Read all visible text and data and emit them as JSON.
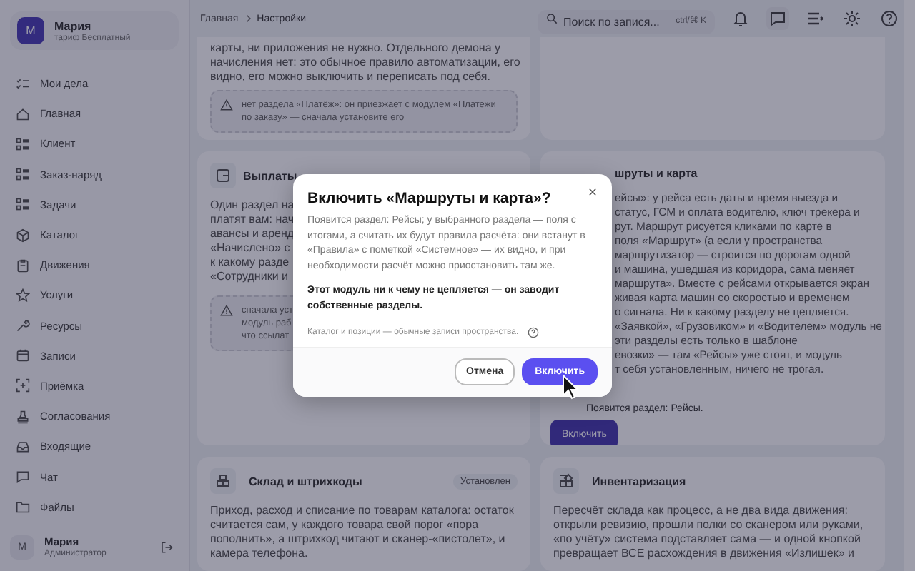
{
  "sidebar": {
    "user": {
      "initial": "М",
      "name": "Мария",
      "plan": "тариф Бесплатный"
    },
    "items": [
      {
        "label": "Мои дела",
        "kind": "tasks"
      },
      {
        "label": "Главная",
        "kind": "home"
      },
      {
        "label": "Клиент",
        "kind": "list"
      },
      {
        "label": "Заказ-наряд",
        "kind": "list"
      },
      {
        "label": "Задачи",
        "kind": "list"
      },
      {
        "label": "Каталог",
        "kind": "box"
      },
      {
        "label": "Движения",
        "kind": "clipboard"
      },
      {
        "label": "Услуги",
        "kind": "star"
      },
      {
        "label": "Ресурсы",
        "kind": "wrench"
      },
      {
        "label": "Записи",
        "kind": "calendar"
      },
      {
        "label": "Приёмка",
        "kind": "scan"
      },
      {
        "label": "Согласования",
        "kind": "stamp"
      },
      {
        "label": "Входящие",
        "kind": "inbox"
      },
      {
        "label": "Чат",
        "kind": "chat"
      },
      {
        "label": "Файлы",
        "kind": "folder"
      }
    ],
    "footer": {
      "initial": "М",
      "name": "Мария",
      "role": "Администратор"
    }
  },
  "header": {
    "breadcrumbs": [
      "Главная",
      "Настройки"
    ],
    "search": {
      "placeholder": "Поиск по запися...",
      "shortcut": "ctrl/⌘ K"
    }
  },
  "cards": {
    "top_left": {
      "lines": [
        "карты, ни приложения не нужно. Отдельного демона у",
        "начисления нет: это обычное правило автоматизации, его",
        "видно, его можно выключить и переписать под себя."
      ],
      "warning": "нет раздела «Платёж»: он приезжает с модулем «Платежи по заказу» — сначала установите его"
    },
    "payouts": {
      "title": "Выплаты",
      "lines": [
        "Один раздел на",
        "платят вам: нач",
        "авансы и аренд",
        "«Начислено» с",
        "к какому разде",
        "«Сотрудники и"
      ],
      "warning_lines": [
        "сначала уст",
        "модуль раб",
        "что ссылат"
      ]
    },
    "routes": {
      "title": "шруты и карта",
      "lines": [
        "ейсы»: у рейса есть даты и время выезда и",
        "статус, ГСМ и оплата водителю, ключ трекера и",
        "рут. Маршрут рисуется кликами по карте в",
        "поля «Маршрут» (а если у пространства",
        "маршрутизатор — строится по дорогам одной",
        "и машина, ушедшая из коридора, сама меняет",
        "маршрута». Вместе с рейсами открывается экран",
        "живая карта машин со скоростью и временем",
        "о сигнала. Ни к какому разделу не цепляется.",
        "«Заявкой», «Грузовиком» и «Водителем» модуль не",
        "эти разделы есть только в шаблоне",
        "евозки» — там «Рейсы» уже стоят, и модуль",
        "т себя установленным, ничего не трогая."
      ],
      "note": "Появится раздел: Рейсы.",
      "button": "Включить"
    },
    "warehouse": {
      "title": "Склад и штрихкоды",
      "badge": "Установлен",
      "body": "Приход, расход и списание по товарам каталога: остаток считается сам, у каждого товара свой порог «пора пополнить», а штрихкод читают и сканер-«пистолет», и камера телефона."
    },
    "inventory": {
      "title": "Инвентаризация",
      "body": "Пересчёт склада как процесс, а не два вида движения: открыли ревизию, прошли полки со сканером или руками, «по учёту» система подставляет сама — и одной кнопкой превращает ВСЕ расхождения в движения «Излишек» и"
    }
  },
  "dialog": {
    "title": "Включить «Маршруты и карта»?",
    "text": "Появится раздел: Рейсы; у выбранного раздела — поля с итогами, а считать их будут правила расчёта: они встанут в «Правила» с пометкой «Системное» — их видно, и при необходимости расчёт можно приостановить там же.",
    "emphasis": "Этот модуль ни к чему не цепляется — он заводит собственные разделы.",
    "note": "Каталог и позиции — обычные записи пространства.",
    "cancel": "Отмена",
    "confirm": "Включить"
  }
}
